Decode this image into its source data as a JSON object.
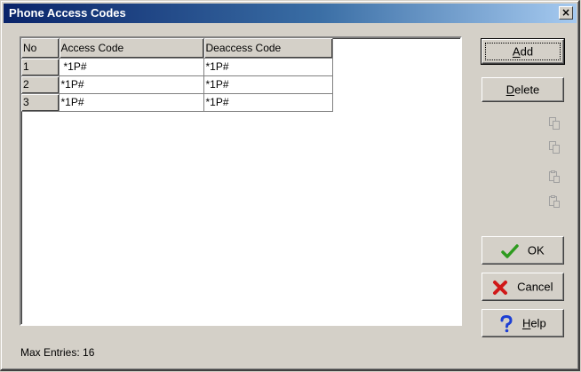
{
  "window": {
    "title": "Phone Access Codes",
    "close_label": "×"
  },
  "grid": {
    "headers": [
      "No",
      "Access Code",
      "Deaccess Code"
    ],
    "rows": [
      {
        "no": "1",
        "access": "*1P#",
        "deaccess": "*1P#"
      },
      {
        "no": "2",
        "access": "*1P#",
        "deaccess": "*1P#"
      },
      {
        "no": "3",
        "access": "*1P#",
        "deaccess": "*1P#"
      }
    ]
  },
  "buttons": {
    "add": {
      "first": "A",
      "rest": "dd"
    },
    "delete": {
      "first": "D",
      "rest": "elete"
    },
    "ok": {
      "label": "OK",
      "icon": "check-icon",
      "color": "#2e9b1f"
    },
    "cancel": {
      "label": "Cancel",
      "icon": "x-icon",
      "color": "#d01818"
    },
    "help": {
      "first": "H",
      "rest": "elp",
      "icon": "question-icon",
      "color": "#1c3fd4"
    }
  },
  "clipboard_icons": [
    "copy-icon",
    "copy-icon",
    "paste-icon",
    "paste-icon"
  ],
  "status": {
    "max_entries": "Max Entries: 16"
  }
}
